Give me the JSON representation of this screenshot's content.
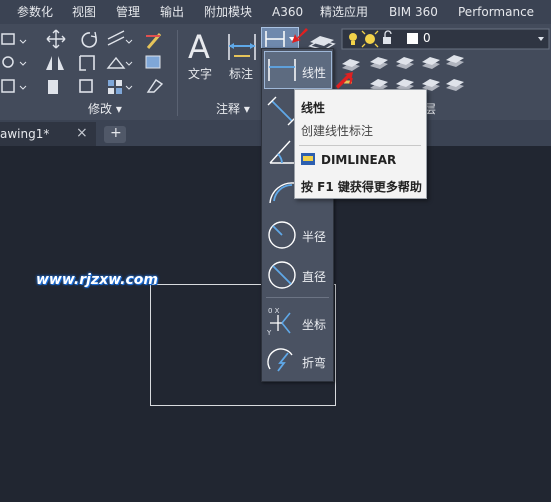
{
  "menubar": {
    "items": [
      "参数化",
      "视图",
      "管理",
      "输出",
      "附加模块",
      "A360",
      "精选应用",
      "BIM 360",
      "Performance"
    ]
  },
  "ribbon": {
    "modify_label": "修改 ▾",
    "annotate_label": "注释 ▾",
    "text_label": "文字",
    "dim_label": "标注",
    "layer_value": "0",
    "cut_label": "层"
  },
  "tabs": {
    "doc_name": "awing1*",
    "close": "×",
    "new_tab": "+"
  },
  "dropdown": {
    "items": [
      "线性",
      "",
      "",
      "",
      "半径",
      "直径",
      "坐标",
      "折弯"
    ]
  },
  "tooltip": {
    "title": "线性",
    "description": "创建线性标注",
    "command": "DIMLINEAR",
    "help": "按 F1 键获得更多帮助"
  },
  "watermark": "www.rjzxw.com",
  "colors": {
    "canvas": "#212631",
    "ribbon": "#434b5b",
    "accent_red": "#e02020",
    "icon_blue": "#5fa8e8"
  }
}
